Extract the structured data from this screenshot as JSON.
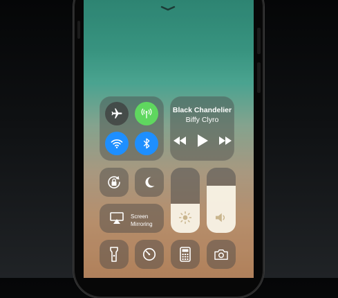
{
  "colors": {
    "airplane_off": "#3c3c3c",
    "cellular_on": "#5fd75f",
    "wifi_on": "#1e8fff",
    "bluetooth_on": "#1e8fff"
  },
  "connectivity": {
    "airplane_mode": false,
    "cellular_data": true,
    "wifi": true,
    "bluetooth": true
  },
  "now_playing": {
    "title": "Black Chandelier",
    "artist": "Biffy Clyro",
    "controls": [
      "rewind-icon",
      "play-icon",
      "fast-forward-icon"
    ]
  },
  "screen_mirroring": {
    "line1": "Screen",
    "line2": "Mirroring"
  },
  "brightness_level": 0.45,
  "volume_level": 0.72,
  "shortcuts": [
    "flashlight-icon",
    "timer-icon",
    "calculator-icon",
    "camera-icon"
  ]
}
